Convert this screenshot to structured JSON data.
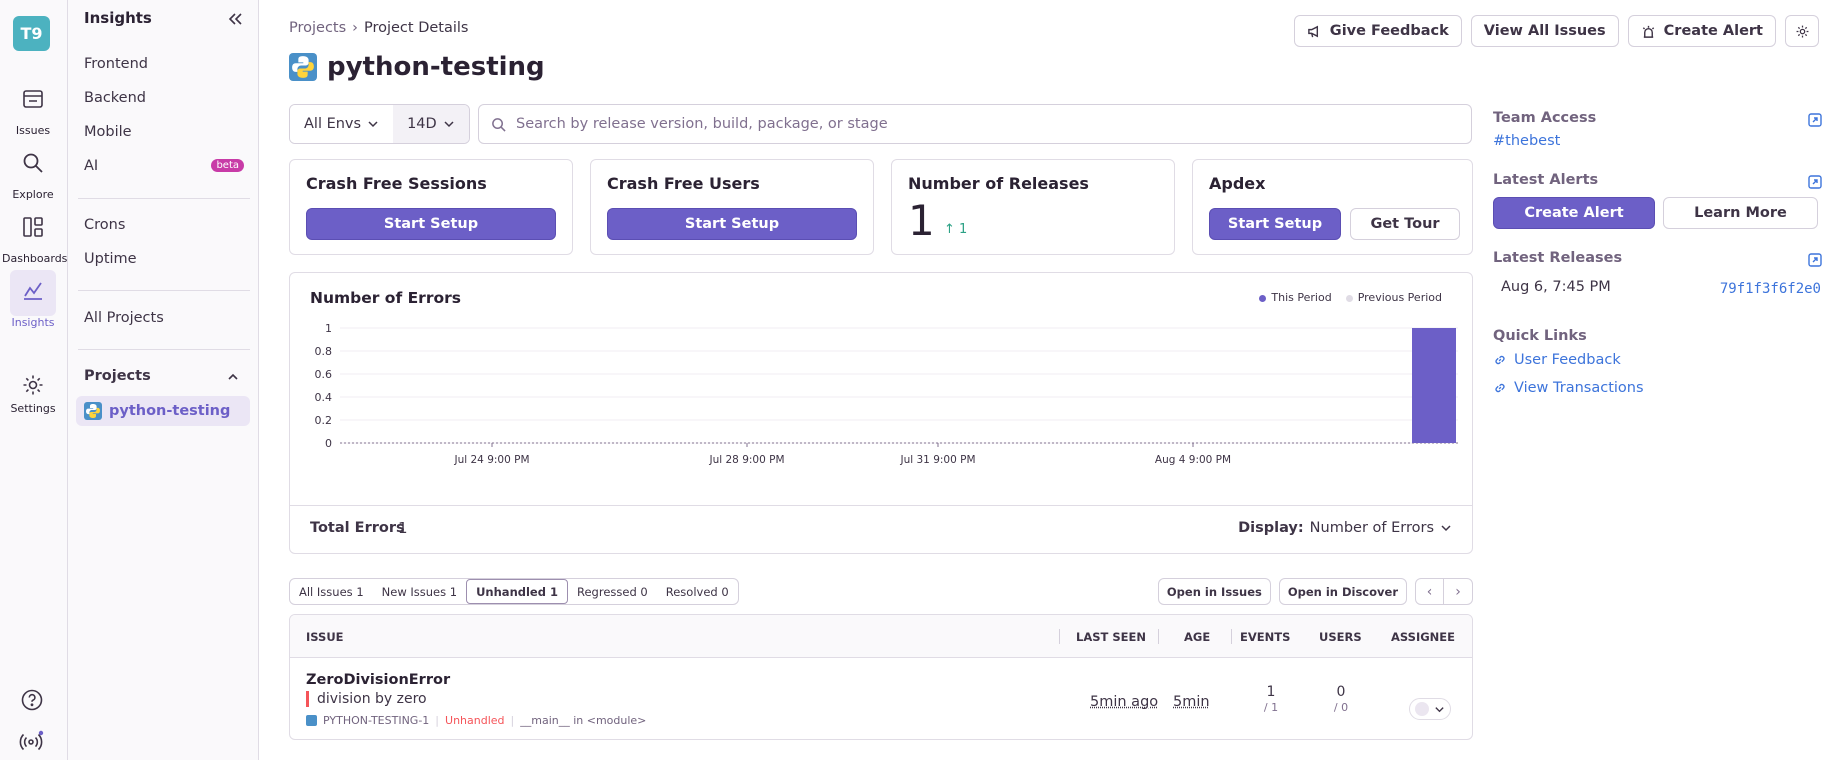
{
  "org": {
    "badge": "T9"
  },
  "rail": {
    "items": [
      {
        "label": "Issues"
      },
      {
        "label": "Explore"
      },
      {
        "label": "Dashboards"
      },
      {
        "label": "Insights"
      },
      {
        "label": "Settings"
      }
    ]
  },
  "subnav": {
    "title": "Insights",
    "items": [
      "Frontend",
      "Backend",
      "Mobile",
      "AI",
      "Crons",
      "Uptime",
      "All Projects"
    ],
    "beta_label": "beta",
    "projects_heading": "Projects",
    "active_project": "python-testing"
  },
  "breadcrumb": {
    "root": "Projects",
    "current": "Project Details"
  },
  "page": {
    "title": "python-testing"
  },
  "actions": {
    "feedback": "Give Feedback",
    "view_issues": "View All Issues",
    "create_alert": "Create Alert"
  },
  "filters": {
    "env": "All Envs",
    "period": "14D"
  },
  "search": {
    "placeholder": "Search by release version, build, package, or stage"
  },
  "cards": {
    "crash_free_sessions": {
      "title": "Crash Free Sessions",
      "button": "Start Setup"
    },
    "crash_free_users": {
      "title": "Crash Free Users",
      "button": "Start Setup"
    },
    "releases": {
      "title": "Number of Releases",
      "value": "1",
      "delta": "1"
    },
    "apdex": {
      "title": "Apdex",
      "button": "Start Setup",
      "secondary": "Get Tour"
    }
  },
  "chart": {
    "legend_this": "This Period",
    "legend_prev": "Previous Period",
    "total_label": "Total Errors",
    "total_value": "1",
    "display_label": "Display:",
    "display_value": "Number of Errors"
  },
  "chart_data": {
    "type": "bar",
    "title": "Number of Errors",
    "xlabel": "",
    "ylabel": "",
    "ylim": [
      0,
      1
    ],
    "yticks": [
      "1",
      "0.8",
      "0.6",
      "0.4",
      "0.2",
      "0"
    ],
    "xticks": [
      "Jul 24 9:00 PM",
      "Jul 28 9:00 PM",
      "Jul 31 9:00 PM",
      "Aug 4 9:00 PM"
    ],
    "series": [
      {
        "name": "This Period",
        "values": [
          0,
          0,
          0,
          0,
          0,
          0,
          0,
          0,
          0,
          0,
          0,
          0,
          0,
          1
        ]
      },
      {
        "name": "Previous Period",
        "values": [
          0,
          0,
          0,
          0,
          0,
          0,
          0,
          0,
          0,
          0,
          0,
          0,
          0,
          0
        ]
      }
    ],
    "colors": {
      "this_period": "#6c5fc7",
      "previous_period": "#e0dce5"
    },
    "grid": true,
    "legend": "top-right"
  },
  "issue_tabs": [
    {
      "label": "All Issues",
      "count": "1"
    },
    {
      "label": "New Issues",
      "count": "1"
    },
    {
      "label": "Unhandled",
      "count": "1"
    },
    {
      "label": "Regressed",
      "count": "0"
    },
    {
      "label": "Resolved",
      "count": "0"
    }
  ],
  "table_actions": {
    "open_issues": "Open in Issues",
    "open_discover": "Open in Discover"
  },
  "table": {
    "headers": {
      "issue": "ISSUE",
      "last_seen": "LAST SEEN",
      "age": "AGE",
      "events": "EVENTS",
      "users": "USERS",
      "assignee": "ASSIGNEE"
    },
    "rows": [
      {
        "title": "ZeroDivisionError",
        "message": "division by zero",
        "short_id": "PYTHON-TESTING-1",
        "handled": "Unhandled",
        "culprit": "__main__ in <module>",
        "last_seen": "5min ago",
        "age": "5min",
        "events": "1",
        "events_total": "/ 1",
        "users": "0",
        "users_total": "/ 0"
      }
    ]
  },
  "sidebar": {
    "team_access": {
      "heading": "Team Access",
      "team": "#thebest"
    },
    "latest_alerts": {
      "heading": "Latest Alerts",
      "create": "Create Alert",
      "learn": "Learn More"
    },
    "latest_releases": {
      "heading": "Latest Releases",
      "date": "Aug 6, 7:45 PM",
      "version": "79f1f3f6f2e0"
    },
    "quick_links": {
      "heading": "Quick Links",
      "links": [
        "User Feedback",
        "View Transactions"
      ]
    }
  }
}
